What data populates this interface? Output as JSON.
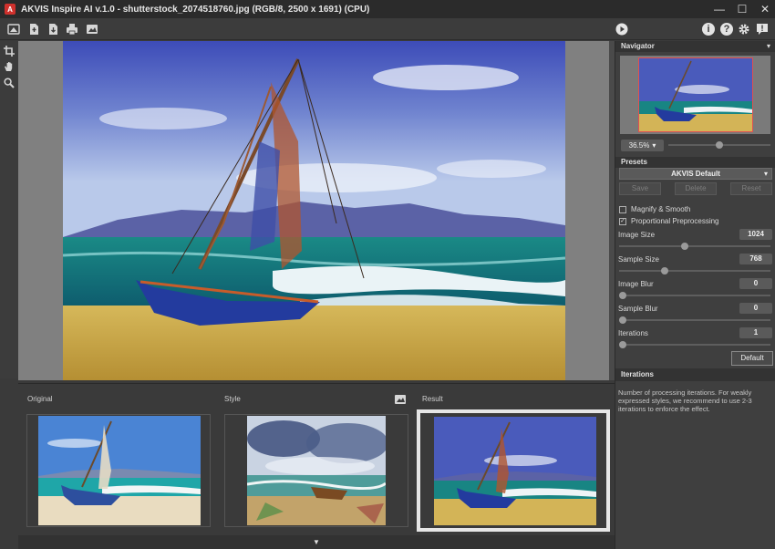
{
  "window": {
    "title": "AKVIS Inspire AI v.1.0 - shutterstock_2074518760.jpg (RGB/8, 2500 x 1691) (CPU)",
    "logo_letter": "A",
    "minimize_glyph": "—",
    "maximize_glyph": "☐",
    "close_glyph": "✕"
  },
  "toolbar": {
    "icons": [
      "before-after-icon",
      "open-file-icon",
      "save-file-icon",
      "print-icon",
      "share-image-icon"
    ],
    "right_icons": [
      "run-icon",
      "info-icon",
      "help-icon",
      "settings-icon",
      "notifications-icon"
    ],
    "info_glyph": "i",
    "help_glyph": "?",
    "notify_glyph": "!"
  },
  "left_tools": [
    "crop-icon",
    "hand-icon",
    "zoom-icon"
  ],
  "bottom_strip": {
    "original_label": "Original",
    "style_label": "Style",
    "result_label": "Result",
    "expand_glyph": "▼"
  },
  "navigator": {
    "header": "Navigator",
    "zoom": "36.5%",
    "zoom_arrow": "▾",
    "zoom_slider_level": 0.5
  },
  "presets": {
    "header": "Presets",
    "selected": "AKVIS Default",
    "save_label": "Save",
    "delete_label": "Delete",
    "reset_label": "Reset"
  },
  "options": {
    "magnify_label": "Magnify & Smooth",
    "magnify_checked": false,
    "proportional_label": "Proportional Preprocessing",
    "proportional_checked": true
  },
  "params": [
    {
      "label": "Image Size",
      "value": "1024",
      "level": 0.43
    },
    {
      "label": "Sample Size",
      "value": "768",
      "level": 0.29
    },
    {
      "label": "Image Blur",
      "value": "0",
      "level": 0
    },
    {
      "label": "Sample Blur",
      "value": "0",
      "level": 0
    },
    {
      "label": "Iterations",
      "value": "1",
      "level": 0
    }
  ],
  "default_button": "Default",
  "hint": {
    "header": "Iterations",
    "text": "Number of processing iterations. For weakly expressed styles, we recommend to use 2-3 iterations to enforce the effect."
  },
  "colors": {
    "accent_red": "#d0312d",
    "panel_bg": "#3f3f3f",
    "canvas_bg": "#808080"
  }
}
